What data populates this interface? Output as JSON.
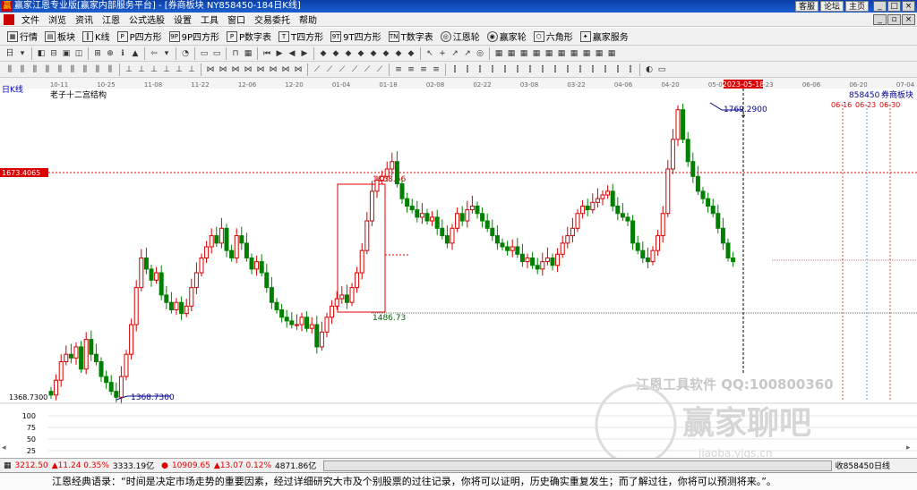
{
  "window": {
    "title": "赢家江恩专业版[赢家内部服务平台] - [券商板块   NY858450-184日K线]",
    "links": [
      "客服",
      "论坛",
      "主页"
    ]
  },
  "menu": [
    "文件",
    "浏览",
    "资讯",
    "江恩",
    "公式选股",
    "设置",
    "工具",
    "窗口",
    "交易委托",
    "帮助"
  ],
  "toolbar": [
    "行情",
    "板块",
    "K线",
    "P四方形",
    "9P四方形",
    "P数字表",
    "T四方形",
    "9T四方形",
    "T数字表",
    "江恩轮",
    "赢家轮",
    "六角形",
    "赢家服务"
  ],
  "chart": {
    "period_label": "日K线",
    "structure_label": "老子十二宫结构",
    "code": "858450",
    "sector_name": "券商板块",
    "high_label": "1769.2900",
    "low_label": "1368.7300",
    "left_low_label": "1368.7300",
    "current_price_label": "1673.4065",
    "box_top_label": "1658.56",
    "box_bottom_label": "1486.73",
    "selected_date": "2023-05-18",
    "future_dates": [
      "06-16",
      "06-23",
      "06-30"
    ],
    "date_axis": [
      "10-11",
      "10-25",
      "11-08",
      "11-22",
      "12-06",
      "12-20",
      "01-04",
      "01-18",
      "02-08",
      "02-22",
      "03-08",
      "03-22",
      "04-06",
      "04-20",
      "05-09",
      "05-23",
      "06-06",
      "06-20",
      "07-04"
    ],
    "volume_axis": [
      "100",
      "75",
      "50",
      "25"
    ],
    "watermark_1": "江恩工具软件  QQ:100800360",
    "watermark_2": "赢家聊吧",
    "watermark_3": "jiaoba.yjgs.cn",
    "colors": {
      "up": "#d80000",
      "down": "#008000",
      "box": "#e00000",
      "cursor": "#000000"
    }
  },
  "status": {
    "index1": "3212.50",
    "index1_change": "▲11.24 0.35%",
    "index1_amount": "3333.19亿",
    "index2": "10909.65",
    "index2_change": "▲13.07 0.12%",
    "index2_amount": "4871.86亿",
    "right_label": "收858450日线"
  },
  "quote": "江恩经典语录：“时间是决定市场走势的重要因素，经过详细研究大市及个别股票的过往记录，你将可以证明，历史确实重复发生；而了解过往，你将可以预测将来。”。"
}
